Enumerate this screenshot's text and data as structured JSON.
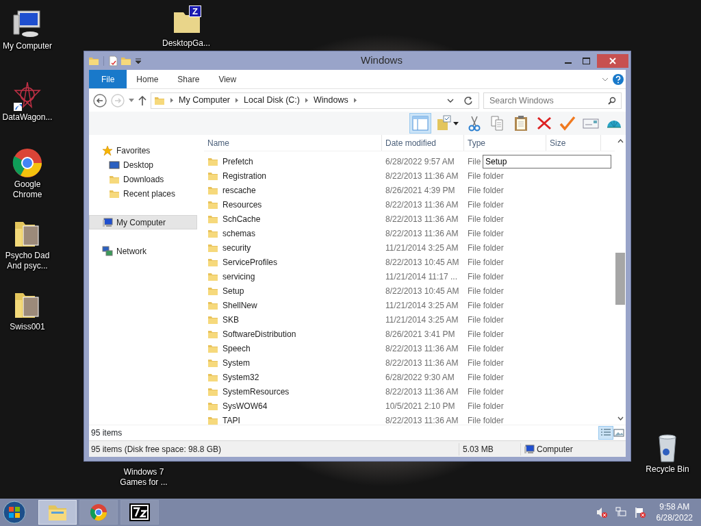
{
  "desktop_icons": [
    {
      "label": "My Computer",
      "kind": "computer"
    },
    {
      "label": "DesktopGa...",
      "kind": "zfolder",
      "badge": "Z"
    },
    {
      "label": "DataWagon...",
      "kind": "star"
    },
    {
      "label": "Google Chrome",
      "kind": "chrome"
    },
    {
      "label": "Psycho Dad And psyc...",
      "kind": "photofolder"
    },
    {
      "label": "Swiss001",
      "kind": "photofolder"
    },
    {
      "label": "Windows 7 Games for ...",
      "kind": "none"
    },
    {
      "label": "Recycle Bin",
      "kind": "recycle"
    }
  ],
  "window": {
    "title": "Windows",
    "ribbon_tabs": [
      {
        "label": "File",
        "selected": true
      },
      {
        "label": "Home",
        "selected": false
      },
      {
        "label": "Share",
        "selected": false
      },
      {
        "label": "View",
        "selected": false
      }
    ],
    "breadcrumb": [
      "My Computer",
      "Local Disk (C:)",
      "Windows"
    ],
    "search": {
      "placeholder": "Search Windows"
    },
    "navigation": [
      {
        "label": "Favorites",
        "kind": "star",
        "selected": false,
        "children": [
          {
            "label": "Desktop",
            "kind": "desktop",
            "selected": false
          },
          {
            "label": "Downloads",
            "kind": "folder",
            "selected": false
          },
          {
            "label": "Recent places",
            "kind": "folder",
            "selected": false
          }
        ]
      },
      {
        "label": "My Computer",
        "kind": "computer",
        "selected": true
      },
      {
        "label": "Network",
        "kind": "network",
        "selected": false
      }
    ],
    "columns": [
      "Name",
      "Date modified",
      "Type",
      "Size"
    ],
    "rows": [
      {
        "name": "Prefetch",
        "date": "6/28/2022 9:57 AM",
        "type": "File"
      },
      {
        "name": "Registration",
        "date": "8/22/2013 11:36 AM",
        "type": "File folder"
      },
      {
        "name": "rescache",
        "date": "8/26/2021 4:39 PM",
        "type": "File folder"
      },
      {
        "name": "Resources",
        "date": "8/22/2013 11:36 AM",
        "type": "File folder"
      },
      {
        "name": "SchCache",
        "date": "8/22/2013 11:36 AM",
        "type": "File folder"
      },
      {
        "name": "schemas",
        "date": "8/22/2013 11:36 AM",
        "type": "File folder"
      },
      {
        "name": "security",
        "date": "11/21/2014 3:25 AM",
        "type": "File folder"
      },
      {
        "name": "ServiceProfiles",
        "date": "8/22/2013 10:45 AM",
        "type": "File folder"
      },
      {
        "name": "servicing",
        "date": "11/21/2014 11:17 ...",
        "type": "File folder"
      },
      {
        "name": "Setup",
        "date": "8/22/2013 10:45 AM",
        "type": "File folder"
      },
      {
        "name": "ShellNew",
        "date": "11/21/2014 3:25 AM",
        "type": "File folder"
      },
      {
        "name": "SKB",
        "date": "11/21/2014 3:25 AM",
        "type": "File folder"
      },
      {
        "name": "SoftwareDistribution",
        "date": "8/26/2021 3:41 PM",
        "type": "File folder"
      },
      {
        "name": "Speech",
        "date": "8/22/2013 11:36 AM",
        "type": "File folder"
      },
      {
        "name": "System",
        "date": "8/22/2013 11:36 AM",
        "type": "File folder"
      },
      {
        "name": "System32",
        "date": "6/28/2022 9:30 AM",
        "type": "File folder"
      },
      {
        "name": "SystemResources",
        "date": "8/22/2013 11:36 AM",
        "type": "File folder"
      },
      {
        "name": "SysWOW64",
        "date": "10/5/2021 2:10 PM",
        "type": "File folder"
      },
      {
        "name": "TAPI",
        "date": "8/22/2013 11:36 AM",
        "type": "File folder"
      }
    ],
    "rename_field": {
      "value": "Setup"
    },
    "item_count": "95 items",
    "status_bar": {
      "summary": "95 items (Disk free space: 98.8 GB)",
      "size": "5.03 MB",
      "location": "Computer"
    }
  },
  "taskbar": {
    "items": [
      {
        "kind": "explorer",
        "selected": true
      },
      {
        "kind": "chrome",
        "selected": false
      },
      {
        "kind": "archive",
        "selected": false
      }
    ],
    "time": "9:58 AM",
    "date": "6/28/2022"
  }
}
